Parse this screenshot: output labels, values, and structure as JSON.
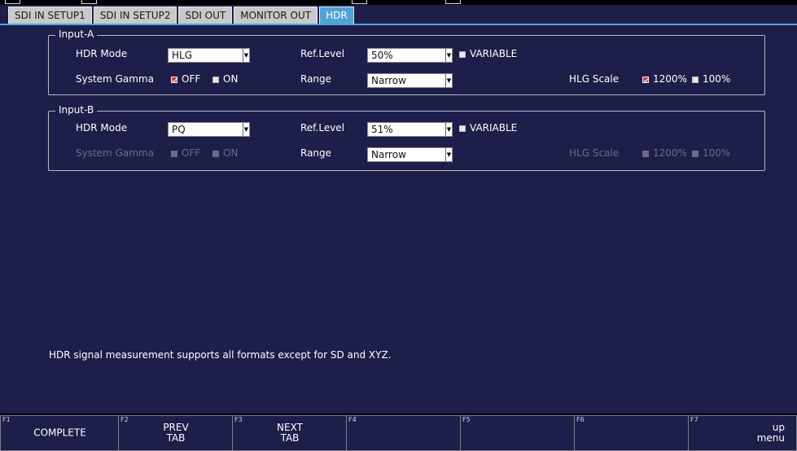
{
  "tabs": [
    {
      "label": "SDI IN SETUP1",
      "active": false
    },
    {
      "label": "SDI IN SETUP2",
      "active": false
    },
    {
      "label": "SDI OUT",
      "active": false
    },
    {
      "label": "MONITOR OUT",
      "active": false
    },
    {
      "label": "HDR",
      "active": true
    }
  ],
  "input_a": {
    "title": "Input-A",
    "hdr_mode_label": "HDR Mode",
    "hdr_mode_value": "HLG",
    "ref_level_label": "Ref.Level",
    "ref_level_value": "50%",
    "variable_label": "VARIABLE",
    "system_gamma_label": "System Gamma",
    "gamma_off_label": "OFF",
    "gamma_on_label": "ON",
    "range_label": "Range",
    "range_value": "Narrow",
    "hlg_scale_label": "HLG Scale",
    "hlg_1200_label": "1200%",
    "hlg_100_label": "100%"
  },
  "input_b": {
    "title": "Input-B",
    "hdr_mode_label": "HDR Mode",
    "hdr_mode_value": "PQ",
    "ref_level_label": "Ref.Level",
    "ref_level_value": "51%",
    "variable_label": "VARIABLE",
    "system_gamma_label": "System Gamma",
    "gamma_off_label": "OFF",
    "gamma_on_label": "ON",
    "range_label": "Range",
    "range_value": "Narrow",
    "hlg_scale_label": "HLG Scale",
    "hlg_1200_label": "1200%",
    "hlg_100_label": "100%"
  },
  "message": "HDR signal measurement supports all formats except for SD and XYZ.",
  "fkeys": [
    {
      "fn": "F1",
      "label": "COMPLETE"
    },
    {
      "fn": "F2",
      "label": "PREV\nTAB"
    },
    {
      "fn": "F3",
      "label": "NEXT\nTAB"
    },
    {
      "fn": "F4",
      "label": ""
    },
    {
      "fn": "F5",
      "label": ""
    },
    {
      "fn": "F6",
      "label": ""
    },
    {
      "fn": "F7",
      "label": "up\nmenu"
    }
  ],
  "colors": {
    "active_tab": "#4fa3d6",
    "background": "#1e1e4a",
    "checked": "#d23a3a"
  }
}
